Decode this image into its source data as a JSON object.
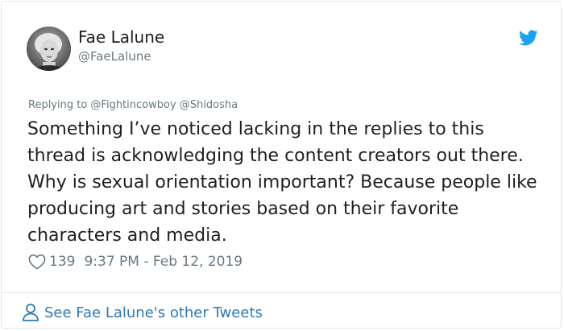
{
  "author": {
    "name": "Fae Lalune",
    "handle": "@FaeLalune"
  },
  "icons": {
    "brand": "twitter-bird-icon",
    "like": "heart-icon",
    "profile": "person-icon"
  },
  "colors": {
    "brand_blue": "#1da1f2",
    "link_blue": "#2b7bb9",
    "muted_gray": "#697882",
    "text": "#1c2022"
  },
  "tweet": {
    "replying_to": "Replying to @Fightincowboy @Shidosha",
    "text": "Something I’ve noticed lacking in the replies to this thread is acknowledging the content creators out there. Why is sexual orientation important? Because people like producing art and stories based on their favorite characters and media.",
    "like_count": "139",
    "timestamp": "9:37 PM - Feb 12, 2019"
  },
  "footer": {
    "link_label": "See Fae Lalune's other Tweets"
  }
}
